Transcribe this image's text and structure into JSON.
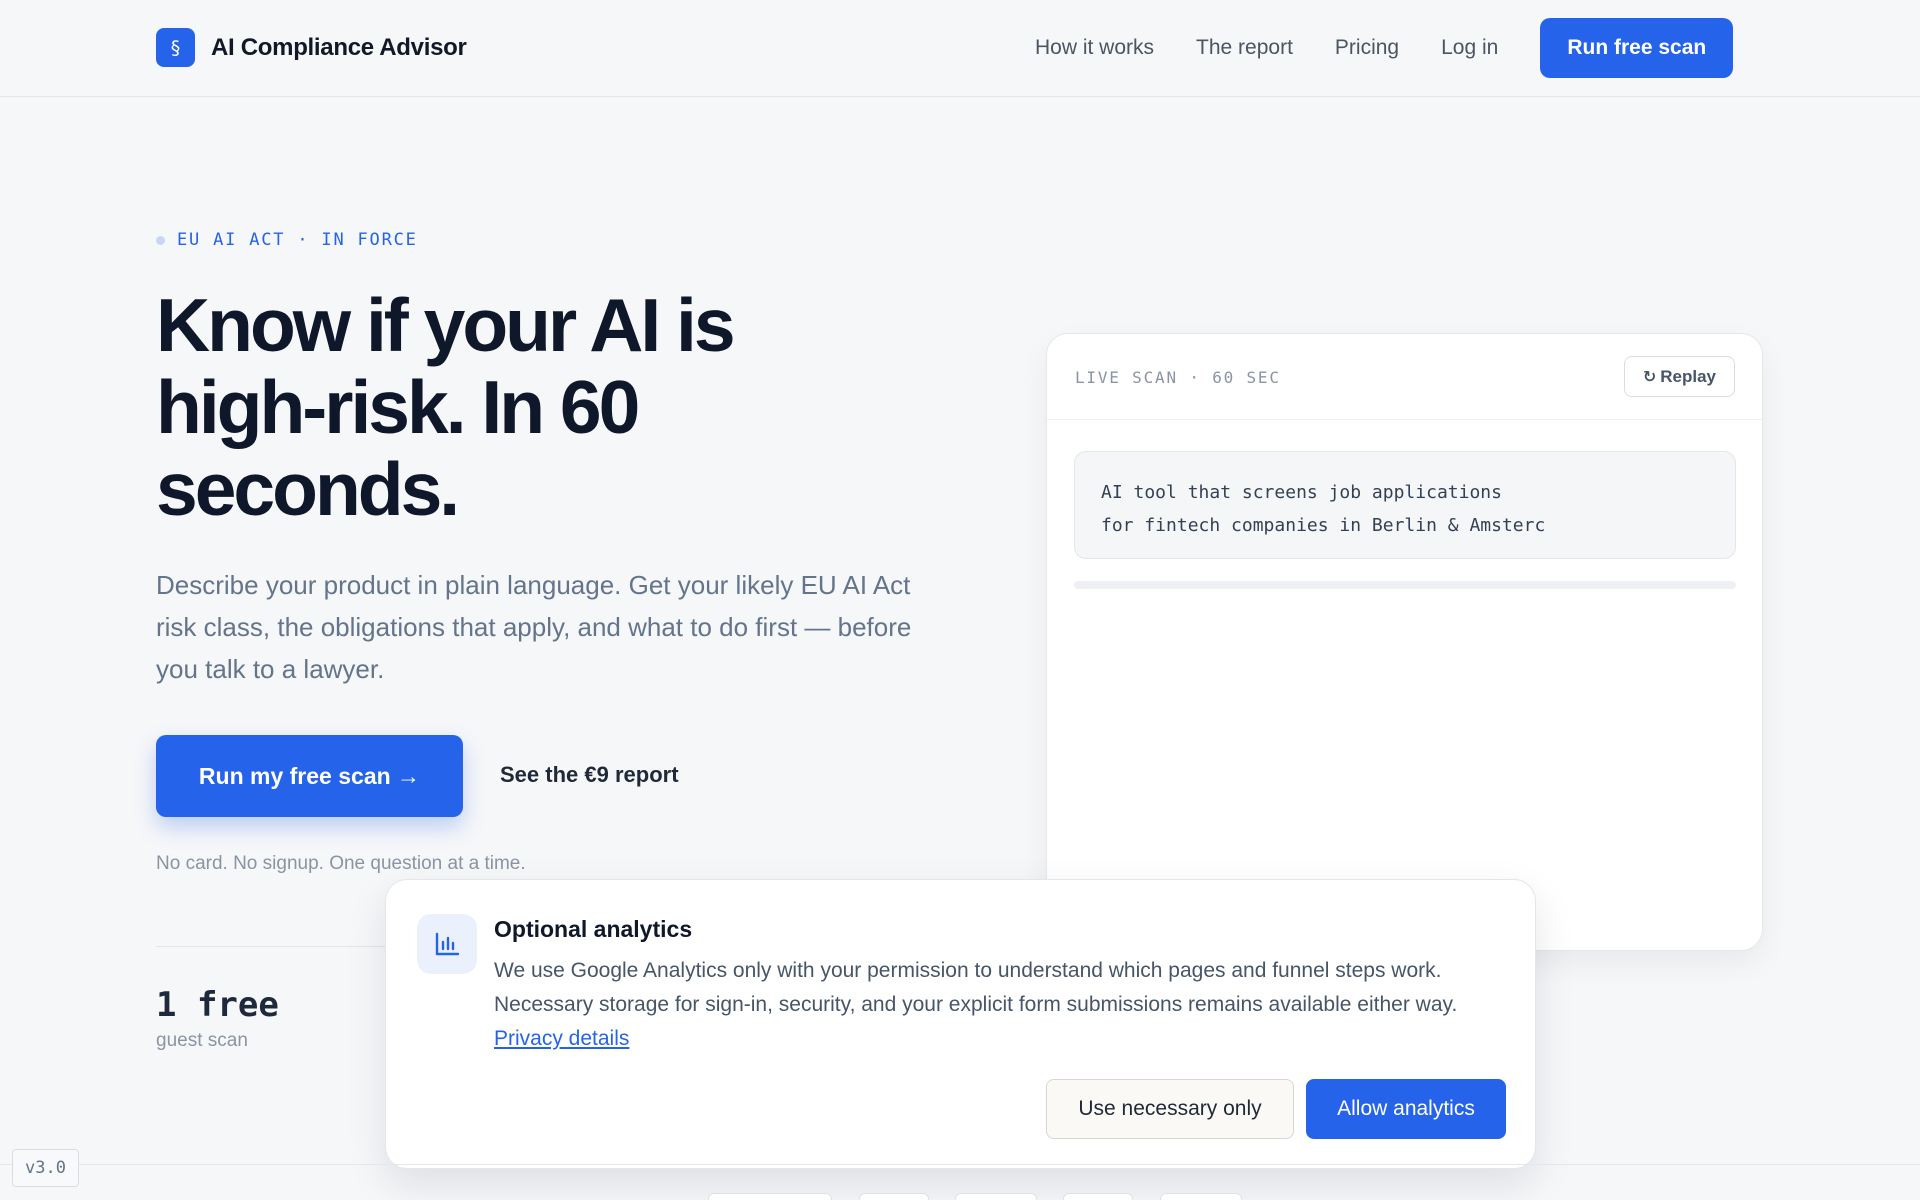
{
  "header": {
    "brand_icon": "§",
    "brand_name": "AI Compliance Advisor",
    "nav": [
      "How it works",
      "The report",
      "Pricing",
      "Log in"
    ],
    "cta": "Run free scan"
  },
  "hero": {
    "eyebrow": "EU AI ACT · IN FORCE",
    "title_line1": "Know if your AI is",
    "title_line2": "high-risk. In 60",
    "title_line3": "seconds.",
    "subtitle": "Describe your product in plain language. Get your likely EU AI Act risk class, the obligations that apply, and what to do first — before you talk to a lawyer.",
    "primary_cta": "Run my free scan →",
    "secondary_cta": "See the €9 report",
    "fineprint": "No card. No signup. One question at a time.",
    "stat_value": "1 free",
    "stat_label": "guest scan"
  },
  "scan_card": {
    "label": "LIVE SCAN · 60 SEC",
    "replay_icon": "↻",
    "replay_label": "Replay",
    "input_line1": "AI tool that screens job applications",
    "input_line2": "for fintech companies in Berlin & Amsterc",
    "progress": 0
  },
  "consent": {
    "icon": "bar-chart-icon",
    "title": "Optional analytics",
    "body": "We use Google Analytics only with your permission to understand which pages and funnel steps work. Necessary storage for sign-in, security, and your explicit form submissions remains available either way.",
    "link": "Privacy details",
    "necessary_button": "Use necessary only",
    "allow_button": "Allow analytics"
  },
  "footer": {
    "version": "v3.0"
  },
  "colors": {
    "accent": "#2563eb",
    "background": "#f6f7f9",
    "text": "#0f172a",
    "muted": "#64748b"
  }
}
